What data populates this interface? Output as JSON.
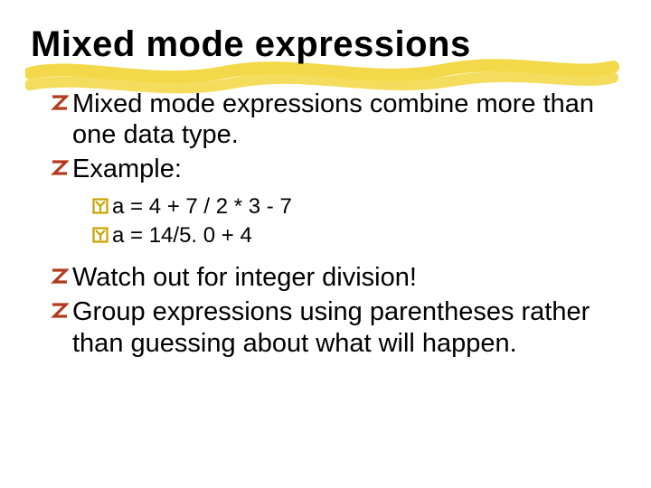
{
  "title": "Mixed mode expressions",
  "bullets_top": [
    "Mixed mode expressions combine more than one data type.",
    "Example:"
  ],
  "sub_bullets": [
    "a = 4 + 7 / 2 * 3 - 7",
    "a = 14/5. 0 + 4"
  ],
  "bullets_bottom": [
    "Watch out for integer division!",
    "Group expressions using parentheses rather than guessing about what will happen."
  ],
  "colors": {
    "z_bullet": "#b23a1f",
    "y_bullet": "#c9a100",
    "highlight": "#f3d94a"
  }
}
